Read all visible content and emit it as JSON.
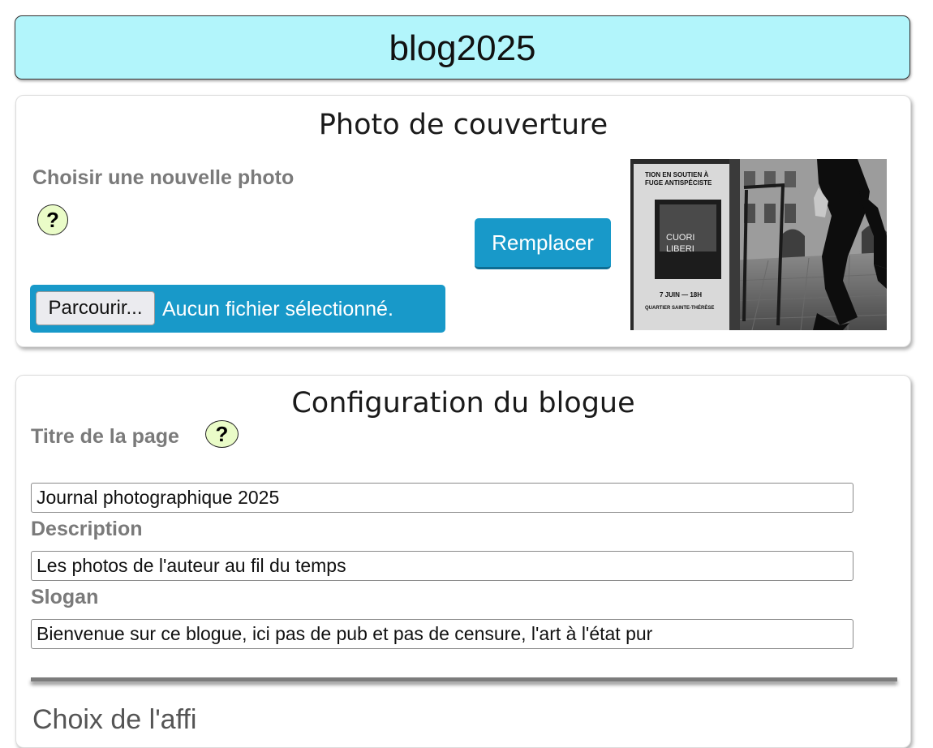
{
  "header": {
    "title": "blog2025"
  },
  "cover": {
    "title": "Photo de couverture",
    "choose_label": "Choisir une nouvelle photo",
    "help": "?",
    "replace_button": "Remplacer",
    "browse_button": "Parcourir...",
    "no_file": "Aucun fichier sélectionné.",
    "photo": {
      "poster_lines": [
        "TION EN SOUTIEN À",
        "FUGE ANTISPÉCISTE",
        "CUORI",
        "LIBERI",
        "7 JUIN — 18H",
        "QUARTIER SAINTE-THÉRÈSE"
      ]
    }
  },
  "config": {
    "title": "Configuration du blogue",
    "page_title_label": "Titre de la page",
    "help": "?",
    "page_title_value": "Journal photographique 2025",
    "description_label": "Description",
    "description_value": "Les photos de l'auteur au fil du temps",
    "slogan_label": "Slogan",
    "slogan_value": "Bienvenue sur ce blogue, ici pas de pub et pas de censure, l'art à l'état pur",
    "next_section_heading_partial": "Choix de l'affi"
  },
  "colors": {
    "header_bg": "#b2f5fb",
    "accent_blue": "#1899c9",
    "help_bg": "#eafcc8",
    "label_gray": "#7a7a7a"
  }
}
